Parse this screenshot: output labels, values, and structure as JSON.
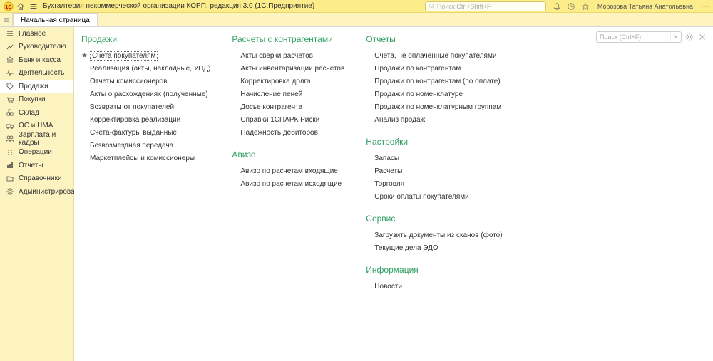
{
  "titlebar": {
    "app_title": "Бухгалтерия некоммерческой организации КОРП, редакция 3.0  (1С:Предприятие)",
    "search_placeholder": "Поиск Ctrl+Shift+F",
    "user_name": "Морозова Татьяна Анатольевна"
  },
  "tabs": {
    "start": "Начальная страница"
  },
  "sidebar": {
    "items": [
      {
        "label": "Главное"
      },
      {
        "label": "Руководителю"
      },
      {
        "label": "Банк и касса"
      },
      {
        "label": "Деятельность"
      },
      {
        "label": "Продажи"
      },
      {
        "label": "Покупки"
      },
      {
        "label": "Склад"
      },
      {
        "label": "ОС и НМА"
      },
      {
        "label": "Зарплата и кадры"
      },
      {
        "label": "Операции"
      },
      {
        "label": "Отчеты"
      },
      {
        "label": "Справочники"
      },
      {
        "label": "Администрирование"
      }
    ]
  },
  "page_controls": {
    "search_placeholder": "Поиск (Ctrl+F)",
    "clear": "×"
  },
  "sections": {
    "col1": {
      "title": "Продажи",
      "links": [
        "Счета покупателям",
        "Реализация (акты, накладные, УПД)",
        "Отчеты комиссионеров",
        "Акты о расхождениях (полученные)",
        "Возвраты от покупателей",
        "Корректировка реализации",
        "Счета-фактуры выданные",
        "Безвозмездная передача",
        "Маркетплейсы и комиссионеры"
      ]
    },
    "col2a": {
      "title": "Расчеты с контрагентами",
      "links": [
        "Акты сверки расчетов",
        "Акты инвентаризации расчетов",
        "Корректировка долга",
        "Начисление пеней",
        "Досье контрагента",
        "Справки 1СПАРК Риски",
        "Надежность дебиторов"
      ]
    },
    "col2b": {
      "title": "Авизо",
      "links": [
        "Авизо по расчетам входящие",
        "Авизо по расчетам исходящие"
      ]
    },
    "col3a": {
      "title": "Отчеты",
      "links": [
        "Счета, не оплаченные покупателями",
        "Продажи по контрагентам",
        "Продажи по контрагентам (по оплате)",
        "Продажи по номенклатуре",
        "Продажи по номенклатурным группам",
        "Анализ продаж"
      ]
    },
    "col3b": {
      "title": "Настройки",
      "links": [
        "Запасы",
        "Расчеты",
        "Торговля",
        "Сроки оплаты покупателями"
      ]
    },
    "col3c": {
      "title": "Сервис",
      "links": [
        "Загрузить документы из сканов (фото)",
        "Текущие дела ЭДО"
      ]
    },
    "col3d": {
      "title": "Информация",
      "links": [
        "Новости"
      ]
    }
  }
}
